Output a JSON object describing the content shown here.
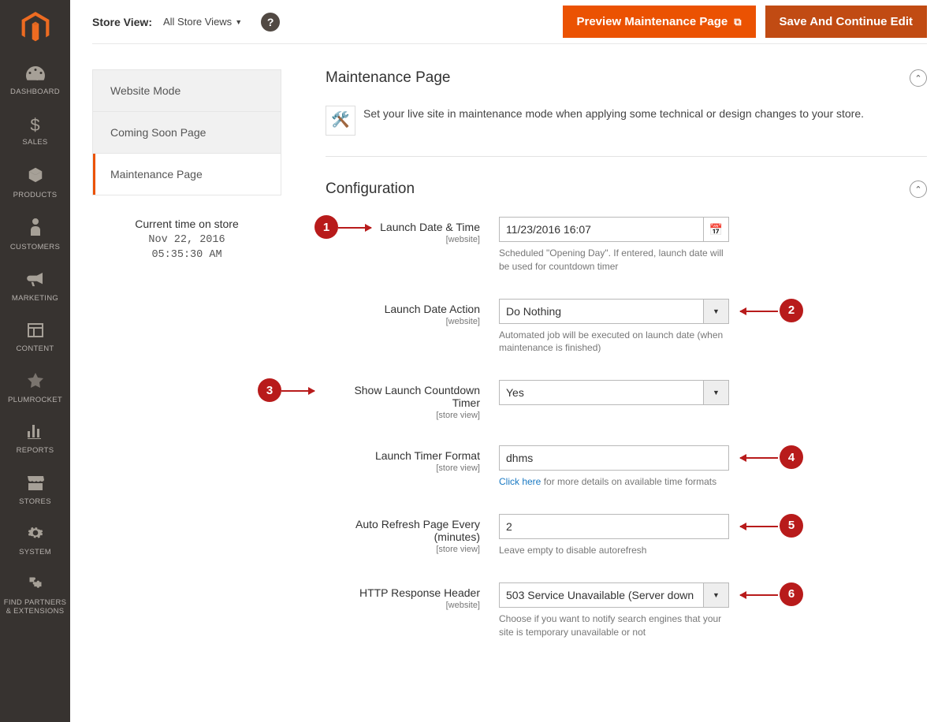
{
  "sidebar": {
    "items": [
      {
        "label": "DASHBOARD"
      },
      {
        "label": "SALES"
      },
      {
        "label": "PRODUCTS"
      },
      {
        "label": "CUSTOMERS"
      },
      {
        "label": "MARKETING"
      },
      {
        "label": "CONTENT"
      },
      {
        "label": "PLUMROCKET"
      },
      {
        "label": "REPORTS"
      },
      {
        "label": "STORES"
      },
      {
        "label": "SYSTEM"
      },
      {
        "label": "FIND PARTNERS & EXTENSIONS"
      }
    ]
  },
  "topbar": {
    "store_view_label": "Store View:",
    "store_view_value": "All Store Views",
    "preview_label": "Preview Maintenance Page",
    "save_label": "Save And Continue Edit"
  },
  "tabs": {
    "items": [
      {
        "label": "Website Mode"
      },
      {
        "label": "Coming Soon Page"
      },
      {
        "label": "Maintenance Page"
      }
    ]
  },
  "timebox": {
    "heading": "Current time on store",
    "date": "Nov 22, 2016",
    "time": "05:35:30 AM"
  },
  "sections": {
    "maint": {
      "title": "Maintenance Page",
      "desc": "Set your live site in maintenance mode when applying some technical or design changes to your store."
    },
    "config": {
      "title": "Configuration"
    }
  },
  "scopes": {
    "website": "[website]",
    "store_view": "[store view]"
  },
  "fields": {
    "launch_date": {
      "label": "Launch Date & Time",
      "value": "11/23/2016 16:07",
      "hint": "Scheduled \"Opening Day\". If entered, launch date will be used for countdown timer"
    },
    "launch_action": {
      "label": "Launch Date Action",
      "value": "Do Nothing",
      "hint": "Automated job will be executed on launch date (when maintenance is finished)"
    },
    "countdown": {
      "label": "Show Launch Countdown Timer",
      "value": "Yes"
    },
    "timer_format": {
      "label": "Launch Timer Format",
      "value": "dhms",
      "hint_link": "Click here",
      "hint_rest": " for more details on available time formats"
    },
    "auto_refresh": {
      "label": "Auto Refresh Page Every (minutes)",
      "value": "2",
      "hint": "Leave empty to disable autorefresh"
    },
    "http_header": {
      "label": "HTTP Response Header",
      "value": "503 Service Unavailable (Server down",
      "hint": "Choose if you want to notify search engines that your site is temporary unavailable or not"
    }
  },
  "annotations": {
    "m1": "1",
    "m2": "2",
    "m3": "3",
    "m4": "4",
    "m5": "5",
    "m6": "6"
  }
}
